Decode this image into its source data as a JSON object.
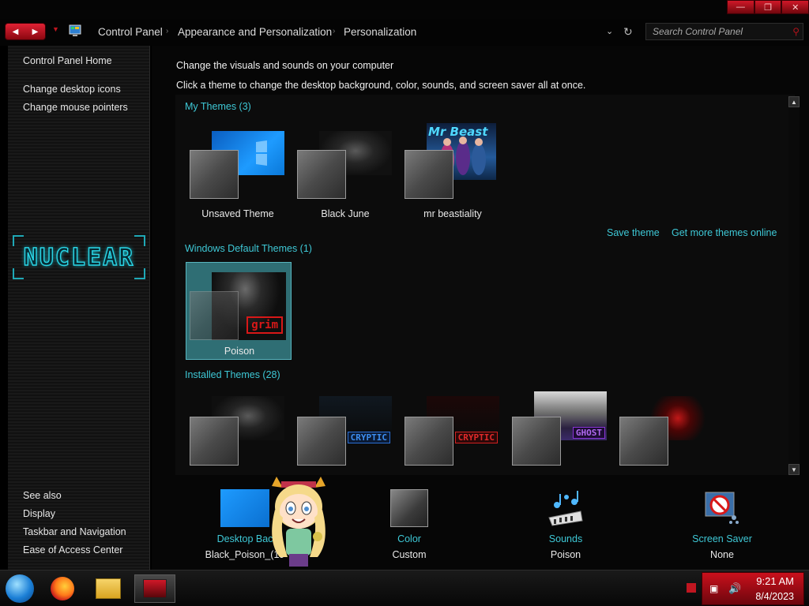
{
  "window": {
    "caption_buttons": [
      "minimize",
      "maximize",
      "close"
    ]
  },
  "addressbar": {
    "breadcrumbs": [
      "Control Panel",
      "Appearance and Personalization",
      "Personalization"
    ],
    "search_placeholder": "Search Control Panel"
  },
  "sidebar": {
    "home": "Control Panel Home",
    "tasks": [
      "Change desktop icons",
      "Change mouse pointers"
    ],
    "logo_text": "NUCLEAR",
    "see_also_title": "See also",
    "see_also": [
      "Display",
      "Taskbar and Navigation",
      "Ease of Access Center"
    ]
  },
  "main": {
    "heading": "Change the visuals and sounds on your computer",
    "subheading": "Click a theme to change the desktop background, color, sounds, and screen saver all at once.",
    "my_themes": {
      "title": "My Themes (3)",
      "items": [
        {
          "name": "Unsaved Theme",
          "wallpaper_color": "#0a78d8"
        },
        {
          "name": "Black June",
          "wallpaper_color": "#1b1b1b"
        },
        {
          "name": "mr beastiality",
          "wallpaper_color": "#1c3a6a",
          "wallpaper_text": "Mr Beast"
        }
      ]
    },
    "save_theme": "Save theme",
    "get_more": "Get more themes online",
    "default_themes": {
      "title": "Windows Default Themes (1)",
      "items": [
        {
          "name": "Poison",
          "selected": true,
          "wallpaper_text": "grim"
        }
      ]
    },
    "installed_themes": {
      "title": "Installed Themes (28)",
      "items": [
        {
          "wallpaper_text": ""
        },
        {
          "wallpaper_text": "CRYPTIC",
          "badge_color": "#2a6fd6"
        },
        {
          "wallpaper_text": "CRYPTIC",
          "badge_color": "#d02020"
        },
        {
          "wallpaper_text": "GHOST",
          "badge_color": "#8a34d6"
        },
        {
          "wallpaper_text": ""
        }
      ]
    }
  },
  "bottom": {
    "desktop_background": {
      "label": "Desktop Bac",
      "value": "Black_Poison_(19"
    },
    "color": {
      "label": "Color",
      "value": "Custom"
    },
    "sounds": {
      "label": "Sounds",
      "value": "Poison"
    },
    "screen_saver": {
      "label": "Screen Saver",
      "value": "None"
    }
  },
  "taskbar": {
    "apps": [
      "start-orb",
      "firefox",
      "file-explorer",
      "control-panel"
    ],
    "clock_time": "9:21 AM",
    "clock_date": "8/4/2023"
  },
  "colors": {
    "accent_red": "#c9101c",
    "link_cyan": "#3ec8d6",
    "selection_teal": "#2f6e74"
  }
}
